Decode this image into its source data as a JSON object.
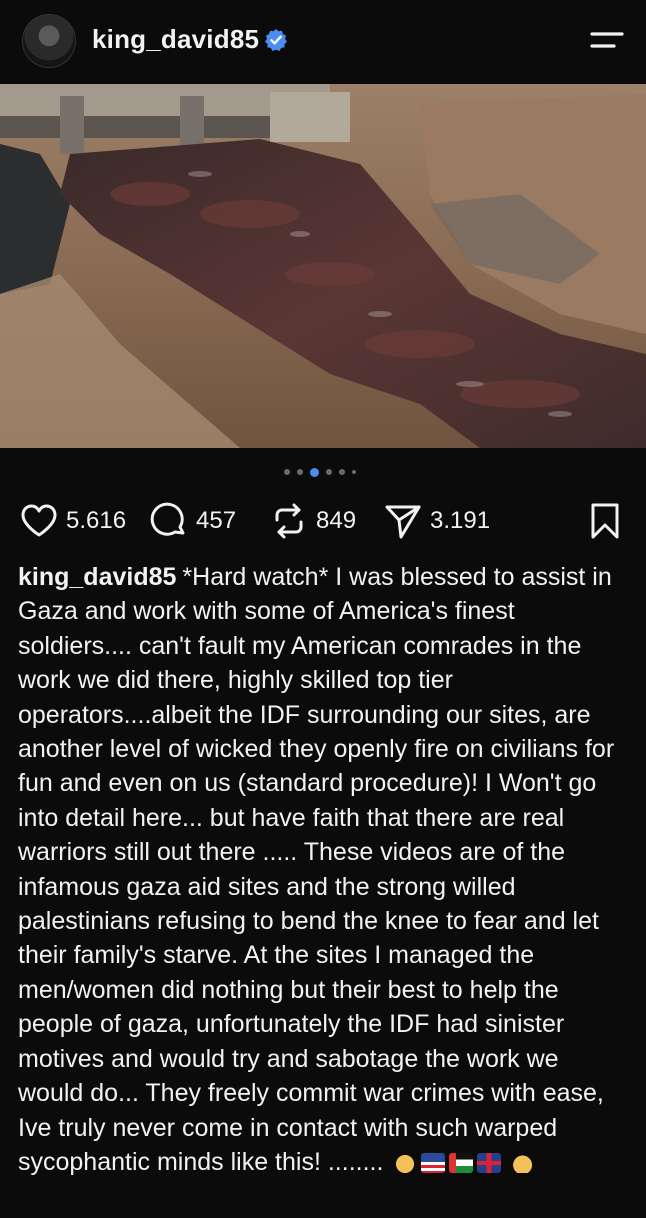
{
  "post": {
    "username": "king_david85",
    "verified": true,
    "accent": "#4d8cf0"
  },
  "carousel": {
    "count": 6,
    "active_index": 2
  },
  "actions": {
    "likes": "5.616",
    "comments": "457",
    "reposts": "849",
    "shares": "3.191"
  },
  "caption": {
    "author": "king_david85",
    "text": "*Hard watch* I was blessed to assist in Gaza and work with some of America's finest soldiers.... can't fault my American comrades in the work we did there, highly skilled top tier operators....albeit the IDF surrounding our sites, are another level of wicked they openly fire on civilians for fun and even on us (standard procedure)! I Won't go into detail here... but have faith that there are real warriors  still out there ..... These videos are of the infamous gaza aid sites and the strong willed palestinians refusing to bend the knee to fear and let their family's starve. At the sites I managed the men/women did nothing but their best to help the people of gaza, unfortunately the IDF had sinister motives and would try and sabotage the work we would do... They freely commit war crimes with ease, Ive truly never come in contact with such warped sycophantic minds like this! ........",
    "emojis": [
      "fist-emoji",
      "us-flag-emoji",
      "palestine-flag-emoji",
      "uk-flag-emoji",
      "flexed-biceps-emoji"
    ]
  }
}
